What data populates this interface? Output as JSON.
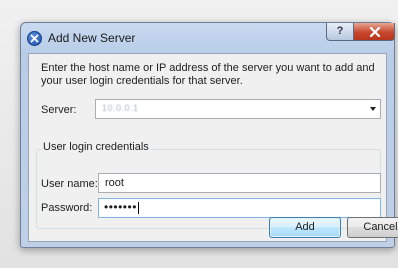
{
  "dialog": {
    "title": "Add New Server",
    "title_icon": "info-circle-icon",
    "help_label": "?",
    "close_icon": "close-icon",
    "instruction": "Enter the host name or IP address of the server you want to add and your user login credentials for that server.",
    "server": {
      "label": "Server:",
      "value": "10.0.0.1"
    },
    "credentials": {
      "group_label": "User login credentials",
      "username_label": "User name:",
      "username_value": "root",
      "password_label": "Password:",
      "password_mask": "•••••••"
    },
    "buttons": {
      "add": "Add",
      "cancel": "Cancel"
    }
  },
  "colors": {
    "title_gradient_top": "#c9daf0",
    "close_button": "#c7472e",
    "default_button_border": "#3c7fb1",
    "focused_field_border": "#7eb4ea"
  }
}
